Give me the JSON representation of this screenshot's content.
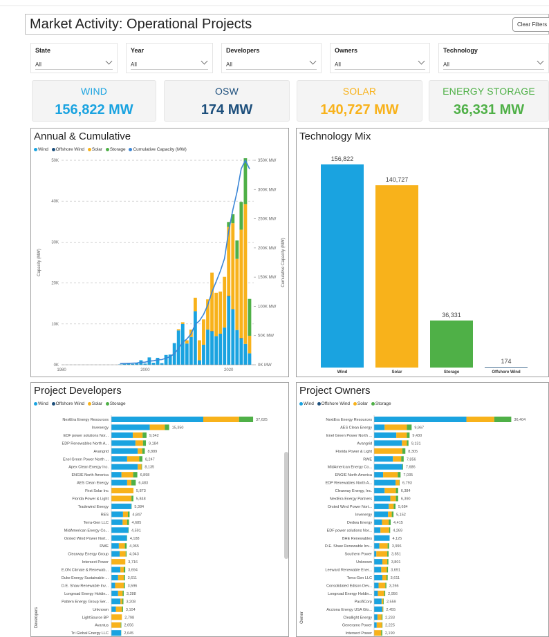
{
  "page": {
    "title": "Market Activity: Operational Projects",
    "clear_filters": "Clear Filters"
  },
  "filters": [
    {
      "label": "State",
      "value": "All"
    },
    {
      "label": "Year",
      "value": "All"
    },
    {
      "label": "Developers",
      "value": "All"
    },
    {
      "label": "Owners",
      "value": "All"
    },
    {
      "label": "Technology",
      "value": "All"
    }
  ],
  "kpis": [
    {
      "label": "WIND",
      "value": "156,822 MW",
      "color": "#1aa3e0"
    },
    {
      "label": "OSW",
      "value": "174 MW",
      "color": "#1d4f7c"
    },
    {
      "label": "SOLAR",
      "value": "140,727 MW",
      "color": "#f8b21b"
    },
    {
      "label": "ENERGY STORAGE",
      "value": "36,331 MW",
      "color": "#4fb047"
    }
  ],
  "panels": {
    "annual": "Annual & Cumulative",
    "mix": "Technology Mix",
    "developers": "Project Developers",
    "owners": "Project Owners"
  },
  "colors": {
    "wind": "#1aa3e0",
    "offshore": "#1d4f7c",
    "solar": "#f8b21b",
    "storage": "#4fb047",
    "cumulative": "#3b86d6"
  },
  "icons": [
    "chevron-down-icon",
    "legend-dot-icon"
  ],
  "chart_data": [
    {
      "type": "bar",
      "title": "Annual & Cumulative",
      "legend": [
        "Wind",
        "Offshore Wind",
        "Solar",
        "Storage",
        "Cumulative Capacity (MW)"
      ],
      "ylabel": "Capacity (MW)",
      "y2label": "Cumulative Capacity (MW)",
      "ylim": [
        0,
        50000
      ],
      "y2lim": [
        0,
        350000
      ],
      "yticks": [
        "0K",
        "10K",
        "20K",
        "30K",
        "40K",
        "50K"
      ],
      "y2ticks": [
        "0K MW",
        "50K MW",
        "100K MW",
        "150K MW",
        "200K MW",
        "250K MW",
        "300K MW",
        "350K MW"
      ],
      "xticks": [
        1980,
        2000,
        2020
      ],
      "xlim": [
        1980,
        2026
      ],
      "x": [
        1994,
        1995,
        1996,
        1997,
        1998,
        1999,
        2000,
        2001,
        2002,
        2003,
        2004,
        2005,
        2006,
        2007,
        2008,
        2009,
        2010,
        2011,
        2012,
        2013,
        2014,
        2015,
        2016,
        2017,
        2018,
        2019,
        2020,
        2021,
        2022,
        2023,
        2024,
        2025
      ],
      "series": [
        {
          "name": "Wind",
          "values": [
            100,
            200,
            300,
            200,
            400,
            1100,
            300,
            1800,
            500,
            1700,
            400,
            2400,
            2500,
            5300,
            8400,
            10000,
            5200,
            6800,
            13100,
            1100,
            4900,
            8600,
            8200,
            7000,
            7600,
            9100,
            16800,
            13600,
            8500,
            6400,
            5100,
            2800
          ]
        },
        {
          "name": "Offshore Wind",
          "values": [
            0,
            0,
            0,
            0,
            0,
            0,
            0,
            0,
            0,
            0,
            0,
            0,
            0,
            0,
            0,
            0,
            0,
            0,
            0,
            0,
            0,
            0,
            30,
            0,
            0,
            0,
            12,
            0,
            0,
            132,
            0,
            0
          ]
        },
        {
          "name": "Solar",
          "values": [
            0,
            0,
            0,
            0,
            0,
            0,
            0,
            0,
            0,
            0,
            0,
            0,
            0,
            0,
            300,
            400,
            800,
            1800,
            3300,
            4900,
            6200,
            7400,
            14300,
            10600,
            10300,
            12400,
            16900,
            21000,
            17400,
            26500,
            34200,
            4300
          ]
        },
        {
          "name": "Storage",
          "values": [
            0,
            0,
            0,
            0,
            0,
            0,
            0,
            0,
            0,
            0,
            0,
            0,
            0,
            0,
            0,
            0,
            0,
            0,
            0,
            0,
            0,
            0,
            0,
            0,
            0,
            0,
            1200,
            2200,
            4500,
            6800,
            11200,
            9000
          ]
        },
        {
          "name": "Cumulative Capacity (MW)",
          "values": [
            2000,
            2200,
            2500,
            2700,
            3100,
            4200,
            4500,
            6300,
            6800,
            8500,
            8900,
            11300,
            13800,
            19100,
            27800,
            38200,
            44200,
            52800,
            69200,
            75200,
            86300,
            102300,
            124800,
            142400,
            160300,
            181800,
            228700,
            265500,
            295900,
            335700,
            375000,
            335000
          ]
        }
      ]
    },
    {
      "type": "bar",
      "title": "Technology Mix",
      "categories": [
        "Wind",
        "Solar",
        "Storage",
        "Offshore Wind"
      ],
      "values": [
        156822,
        140727,
        36331,
        174
      ],
      "labels": [
        "156,822",
        "140,727",
        "36,331",
        "174"
      ],
      "ylim": [
        0,
        160000
      ]
    },
    {
      "type": "bar",
      "orientation": "horizontal",
      "stacked": true,
      "title": "Project Developers",
      "ylabel": "Developers",
      "legend": [
        "Wind",
        "Offshore Wind",
        "Solar",
        "Storage"
      ],
      "xlim": [
        0,
        40000
      ],
      "categories": [
        "NextEra Energy Resources",
        "Invenergy",
        "EDF power solutions Nor...",
        "EDP Renewables North A...",
        "Avangrid",
        "Enel Green Power North ...",
        "Apex Clean Energy Inc.",
        "ENGIE North America",
        "AES Clean Energy",
        "First Solar Inc",
        "Florida Power & Light",
        "Tradewind Energy",
        "RES",
        "Terra-Gen LLC",
        "MidAmerican Energy Co...",
        "Orsted Wind Power Nort...",
        "RWE",
        "Clearway Energy Group",
        "Intersect Power",
        "E.ON Climate & Renewab...",
        "Duke Energy Sustainable ...",
        "D.E. Shaw Renewable Inv...",
        "Longroad Energy Holdin...",
        "Pattern Energy Group Ser...",
        "Unknown",
        "LightSource BP",
        "Avantus",
        "Tri Global Energy LLC"
      ],
      "labels": [
        "37,625",
        "15,350",
        "9,342",
        "9,184",
        "8,889",
        "8,247",
        "8,135",
        "6,898",
        "6,483",
        "5,873",
        "5,848",
        "5,384",
        "4,847",
        "4,685",
        "4,591",
        "4,188",
        "4,065",
        "4,043",
        "3,716",
        "3,694",
        "3,611",
        "3,596",
        "3,288",
        "3,208",
        "3,104",
        "2,798",
        "2,656",
        "2,645"
      ],
      "series": [
        {
          "name": "Wind",
          "values": [
            24400,
            10200,
            5700,
            6400,
            7000,
            4200,
            7000,
            2700,
            4200,
            0,
            0,
            5300,
            3100,
            3000,
            4500,
            4100,
            2000,
            2200,
            0,
            2400,
            1800,
            1000,
            1800,
            2400,
            1200,
            0,
            0,
            2600
          ]
        },
        {
          "name": "Offshore Wind",
          "values": [
            0,
            0,
            0,
            0,
            0,
            0,
            0,
            0,
            0,
            0,
            0,
            0,
            0,
            0,
            0,
            0,
            0,
            0,
            0,
            0,
            0,
            0,
            0,
            0,
            0,
            0,
            0,
            0
          ]
        },
        {
          "name": "Solar",
          "values": [
            9500,
            4000,
            2600,
            2000,
            1200,
            3200,
            1000,
            3100,
            1100,
            5873,
            5348,
            0,
            1300,
            1200,
            0,
            0,
            1600,
            1600,
            3716,
            900,
            1500,
            2300,
            1200,
            500,
            1600,
            2798,
            2500,
            0
          ]
        },
        {
          "name": "Storage",
          "values": [
            3725,
            1150,
            1042,
            784,
            689,
            847,
            135,
            1098,
            1183,
            0,
            500,
            84,
            447,
            485,
            91,
            88,
            465,
            243,
            0,
            394,
            311,
            296,
            288,
            308,
            304,
            0,
            156,
            45
          ]
        }
      ]
    },
    {
      "type": "bar",
      "orientation": "horizontal",
      "stacked": true,
      "title": "Project Owners",
      "ylabel": "Owner",
      "legend": [
        "Wind",
        "Offshore Wind",
        "Solar",
        "Storage"
      ],
      "xlim": [
        0,
        40000
      ],
      "categories": [
        "NextEra Energy Resources",
        "AES Clean Energy",
        "Enel Green Power North ...",
        "Avangrid",
        "Florida Power & Light",
        "RWE",
        "MidAmerican Energy Co...",
        "ENGIE North America",
        "EDP Renewables North A...",
        "Clearway Energy, Inc.",
        "NextEra Energy Partners",
        "Orsted Wind Power Nort...",
        "Invenergy",
        "Dedwa Energy",
        "EDF power solutions Nor...",
        "BHE Renewables",
        "D.E. Shaw Renewable Inv...",
        "Southern Power",
        "Unknown",
        "Leeward Renewable Ener...",
        "Terra-Gen LLC",
        "Consolidated Edison Dev...",
        "Longroad Energy Holdin...",
        "PacifiCorp",
        "Acciona Energy USA Glo...",
        "Cleallight Energy",
        "Generamo Power",
        "Intersect Power"
      ],
      "labels": [
        "36,404",
        "9,967",
        "9,430",
        "9,131",
        "8,305",
        "7,856",
        "7,686",
        "7,035",
        "6,793",
        "6,384",
        "6,390",
        "5,684",
        "5,152",
        "4,415",
        "4,269",
        "4,125",
        "3,996",
        "3,851",
        "3,801",
        "3,691",
        "3,611",
        "3,266",
        "2,956",
        "2,559",
        "2,455",
        "2,233",
        "2,225",
        "2,190"
      ],
      "series": [
        {
          "name": "Wind",
          "values": [
            24500,
            2800,
            5900,
            7400,
            0,
            5000,
            7500,
            2400,
            5700,
            2800,
            4300,
            3900,
            3700,
            2100,
            1700,
            4125,
            1400,
            600,
            2200,
            1900,
            2200,
            1200,
            1000,
            2000,
            2200,
            900,
            700,
            0
          ]
        },
        {
          "name": "Offshore Wind",
          "values": [
            0,
            0,
            0,
            0,
            0,
            0,
            0,
            0,
            0,
            0,
            0,
            0,
            0,
            0,
            0,
            0,
            0,
            0,
            0,
            0,
            0,
            0,
            0,
            0,
            0,
            0,
            0,
            0
          ]
        },
        {
          "name": "Solar",
          "values": [
            7400,
            5900,
            2800,
            1300,
            7500,
            2200,
            0,
            3900,
            1000,
            3000,
            1500,
            1300,
            1000,
            1800,
            2300,
            0,
            2200,
            2900,
            1300,
            1500,
            1100,
            1800,
            1700,
            400,
            200,
            1100,
            1400,
            1900
          ]
        },
        {
          "name": "Storage",
          "values": [
            4504,
            1267,
            730,
            431,
            805,
            656,
            186,
            735,
            93,
            584,
            590,
            484,
            452,
            515,
            269,
            0,
            396,
            351,
            301,
            291,
            311,
            266,
            256,
            159,
            55,
            233,
            125,
            290
          ]
        }
      ]
    }
  ]
}
